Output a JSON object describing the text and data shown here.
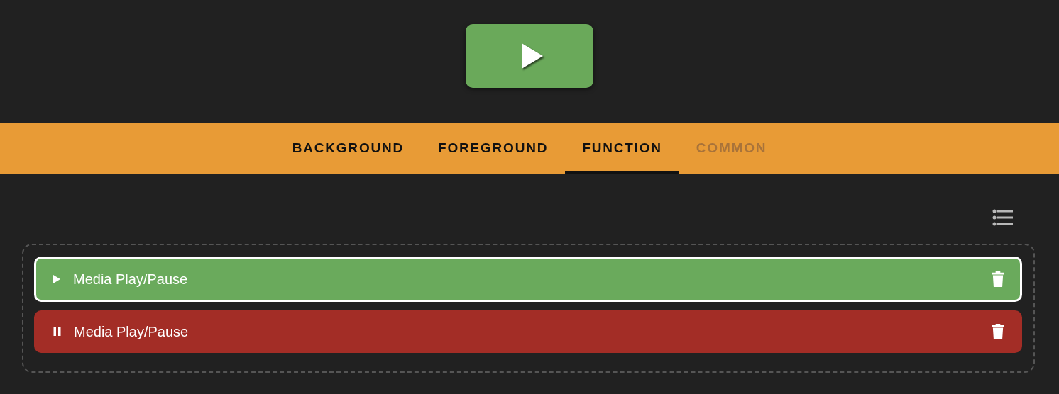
{
  "play_button": {
    "kind": "play"
  },
  "tabs": [
    {
      "label": "BACKGROUND",
      "selected": false,
      "disabled": false
    },
    {
      "label": "FOREGROUND",
      "selected": false,
      "disabled": false
    },
    {
      "label": "FUNCTION",
      "selected": true,
      "disabled": false
    },
    {
      "label": "COMMON",
      "selected": false,
      "disabled": true
    }
  ],
  "actions": [
    {
      "kind": "play",
      "label": "Media Play/Pause",
      "color": "#6aaa5c",
      "selected": true
    },
    {
      "kind": "pause",
      "label": "Media Play/Pause",
      "color": "#a32d26",
      "selected": false
    }
  ]
}
